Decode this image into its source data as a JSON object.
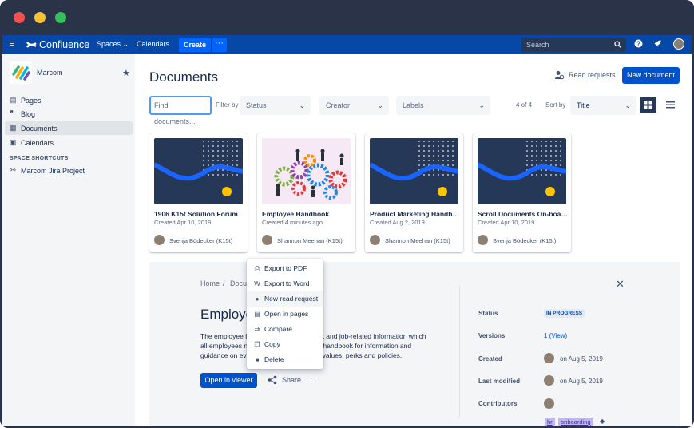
{
  "window": {
    "title": ""
  },
  "topnav": {
    "brand": "Confluence",
    "spaces": "Spaces",
    "calendars": "Calendars",
    "create": "Create",
    "more": "···",
    "search_placeholder": "Search"
  },
  "sidebar": {
    "space_name": "Marcom",
    "items": [
      {
        "label": "Pages",
        "icon": "page-icon"
      },
      {
        "label": "Blog",
        "icon": "quote-icon"
      },
      {
        "label": "Documents",
        "icon": "documents-icon"
      },
      {
        "label": "Calendars",
        "icon": "calendar-icon"
      }
    ],
    "shortcuts_heading": "SPACE SHORTCUTS",
    "shortcut": "Marcom Jira Project"
  },
  "main": {
    "title": "Documents",
    "read_requests": "Read requests",
    "new_document": "New document",
    "filter_placeholder": "Find documents...",
    "filter_by": "Filter by",
    "status": "Status",
    "creator": "Creator",
    "labels": "Labels",
    "count": "4 of 4",
    "sort_by": "Sort by",
    "sort_value": "Title"
  },
  "cards": [
    {
      "title": "1906 K15t Solution Forum",
      "date": "Created Apr 10, 2019",
      "author": "Svenja Bödecker (K15t)"
    },
    {
      "title": "Employee Handbook",
      "date": "Created 4 minutes ago",
      "author": "Shannon Meehan (K15t)"
    },
    {
      "title": "Product Marketing Handbook",
      "date": "Created Aug 2, 2019",
      "author": "Shannon Meehan (K15t)"
    },
    {
      "title": "Scroll Documents On-boarding",
      "date": "Created Apr 10, 2019",
      "author": "Svenja Bödecker (K15t)"
    }
  ],
  "detail": {
    "bc_home": "Home",
    "bc_sep": "/",
    "bc_docs": "Docu",
    "title": "Employe",
    "desc_line1": "The employee h                              yment and job-related information which",
    "desc_line2": "all employees n                              to the handbook for information and",
    "desc_line3": "guidance on eve                              ture, values, perks and policies.",
    "open_viewer": "Open in viewer",
    "share": "Share",
    "more": "···",
    "status_label": "Status",
    "status_value": "IN PROGRESS",
    "versions_label": "Versions",
    "versions_value": "1 (View)",
    "created_label": "Created",
    "created_value": "on Aug 5, 2019",
    "modified_label": "Last modified",
    "modified_value": "on Aug 5, 2019",
    "contributors_label": "Contributors",
    "tag1": "hr",
    "tag2": "onboarding"
  },
  "context_menu": {
    "items": [
      {
        "label": "Export to PDF",
        "icon": "pdf-icon"
      },
      {
        "label": "Export to Word",
        "icon": "word-icon"
      },
      {
        "label": "New read request",
        "icon": "read-request-icon"
      },
      {
        "label": "Open in pages",
        "icon": "pages-icon"
      },
      {
        "label": "Compare",
        "icon": "compare-icon"
      },
      {
        "label": "Copy",
        "icon": "copy-icon"
      },
      {
        "label": "Delete",
        "icon": "trash-icon"
      }
    ]
  },
  "colors": {
    "nav": "#0747a6",
    "primary": "#0052cc",
    "thumb_bg": "#253858",
    "thumb_wave": "#1a64ff",
    "thumb_sun": "#ffc400"
  }
}
